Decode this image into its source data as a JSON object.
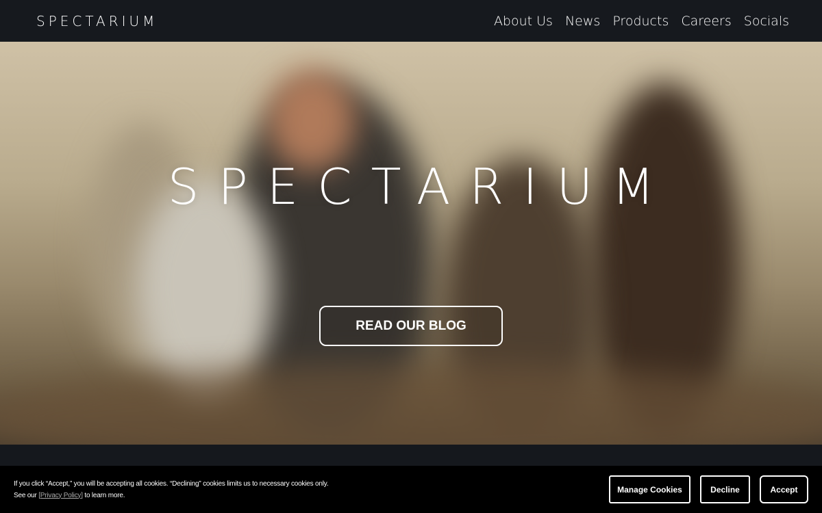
{
  "header": {
    "logo": "SPECTARIUM",
    "nav": [
      "About Us",
      "News",
      "Products",
      "Careers",
      "Socials"
    ]
  },
  "hero": {
    "logo": "SPECTARIUM",
    "cta": "READ OUR BLOG"
  },
  "cookie": {
    "line1": "If you click “Accept,” you will be accepting all cookies. “Declining” cookies limits us to necessary cookies only.",
    "line2_pre": "See our ",
    "line2_link": "[Privacy Policy]",
    "line2_post": " to learn more.",
    "manage": "Manage Cookies",
    "decline": "Decline",
    "accept": "Accept"
  },
  "colors": {
    "header_bg": "#16191e",
    "cookie_bg": "#000000",
    "text": "#ffffff"
  }
}
